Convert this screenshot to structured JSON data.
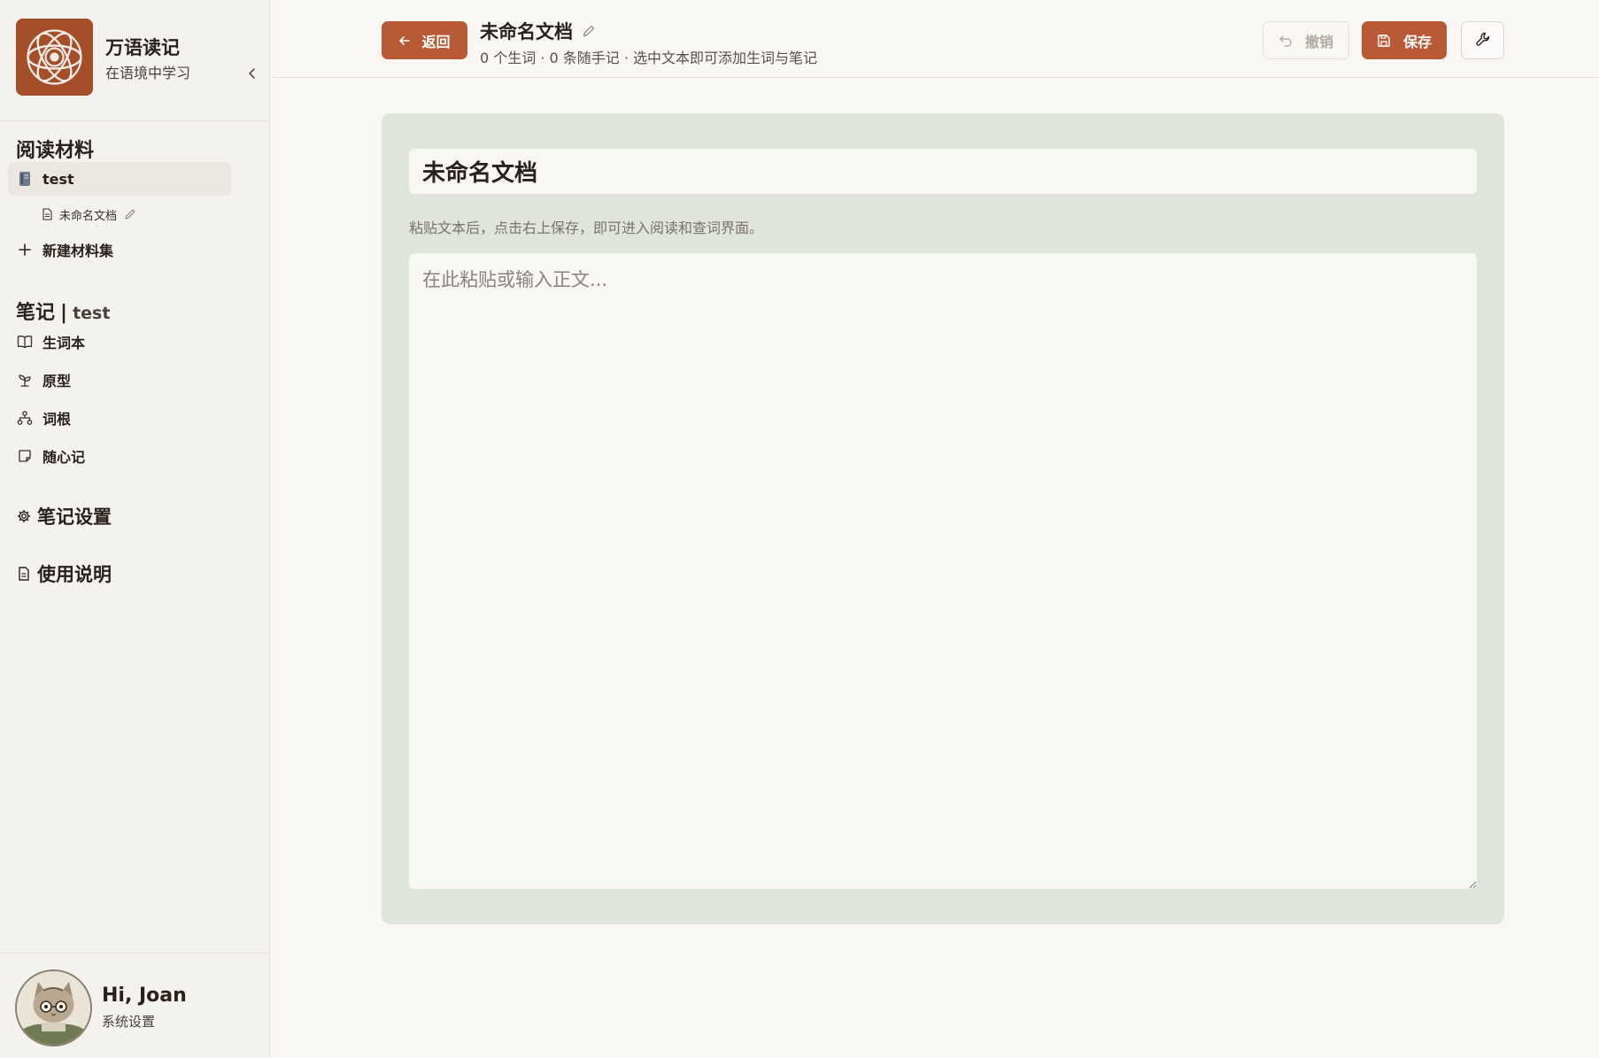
{
  "app": {
    "name": "万语读记",
    "tagline": "在语境中学习",
    "logo_icon": "flower-mandala-logo"
  },
  "sidebar": {
    "materials_title": "阅读材料",
    "collections": [
      {
        "label": "test",
        "icon": "notebook-icon",
        "active": true
      }
    ],
    "documents": [
      {
        "label": "未命名文档",
        "icon": "file-text-icon"
      }
    ],
    "new_collection_label": "新建材料集",
    "notes_title": "笔记",
    "notes_separator": "|",
    "notes_collection": "test",
    "notes_items": [
      {
        "label": "生词本",
        "icon": "book-open-icon"
      },
      {
        "label": "原型",
        "icon": "sprout-icon"
      },
      {
        "label": "词根",
        "icon": "network-icon"
      },
      {
        "label": "随心记",
        "icon": "sticky-note-icon"
      }
    ],
    "settings_label": "笔记设置",
    "help_label": "使用说明"
  },
  "user": {
    "greeting": "Hi, Joan",
    "settings_label": "系统设置",
    "avatar": "cat-with-glasses-avatar"
  },
  "toolbar": {
    "back_label": "返回",
    "doc_title": "未命名文档",
    "doc_meta": "0 个生词 · 0 条随手记 · 选中文本即可添加生词与笔记",
    "undo_label": "撤销",
    "save_label": "保存"
  },
  "editor": {
    "title_value": "未命名文档",
    "hint": "粘贴文本后，点击右上保存，即可进入阅读和查词界面。",
    "body_placeholder": "在此粘贴或输入正文...",
    "body_value": ""
  },
  "colors": {
    "accent": "#b85a36",
    "sidebar_bg": "#f4f2ee",
    "page_bg": "#f8f7f4",
    "panel_bg": "#dfe5db",
    "logo_bg": "#a44f2a"
  }
}
